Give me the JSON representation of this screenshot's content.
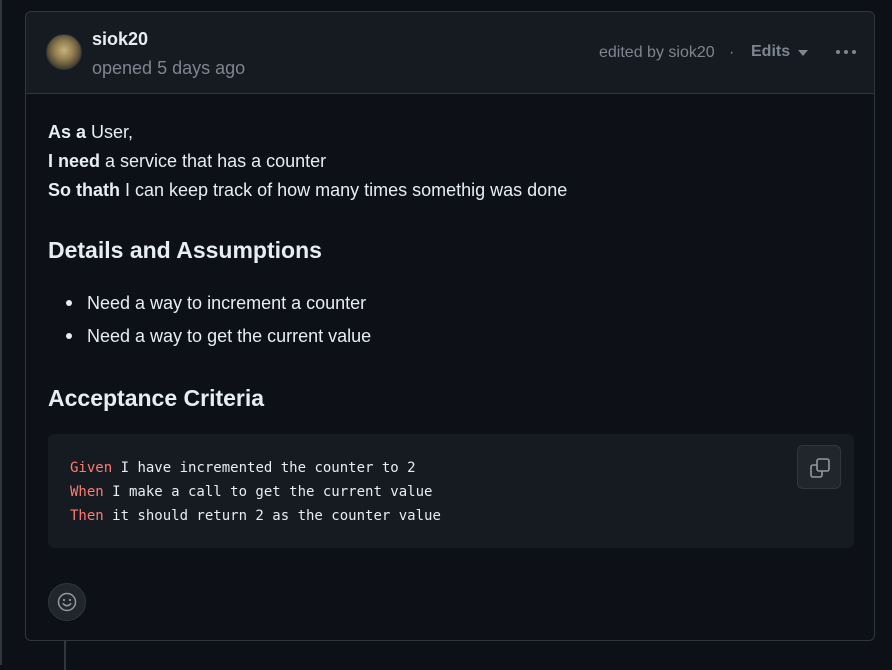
{
  "header": {
    "author": "siok20",
    "opened": "opened 5 days ago",
    "edited": "edited by siok20",
    "separator": "·",
    "edits_label": "Edits"
  },
  "story": [
    {
      "bold": "As a",
      "text": " User,"
    },
    {
      "bold": "I need",
      "text": " a service that has a counter"
    },
    {
      "bold": "So thath",
      "text": " I can keep track of how many times somethig was done"
    }
  ],
  "details": {
    "heading": "Details and Assumptions",
    "items": [
      "Need a way to increment a counter",
      "Need a way to get the current value"
    ]
  },
  "acceptance": {
    "heading": "Acceptance Criteria",
    "lines": [
      {
        "keyword": "Given",
        "text": " I have incremented the counter to 2"
      },
      {
        "keyword": "When",
        "text": " I make a call to get the current value"
      },
      {
        "keyword": "Then",
        "text": " it should return 2 as the counter value"
      }
    ]
  },
  "icons": {
    "copy": "copy-icon",
    "reaction": "smiley-icon",
    "more": "kebab-horizontal-icon",
    "caret": "triangle-down-icon"
  },
  "colors": {
    "background": "#0d1117",
    "header_bg": "#161b22",
    "border": "#30363d",
    "muted": "#7d8590",
    "keyword": "#ff7b72"
  }
}
